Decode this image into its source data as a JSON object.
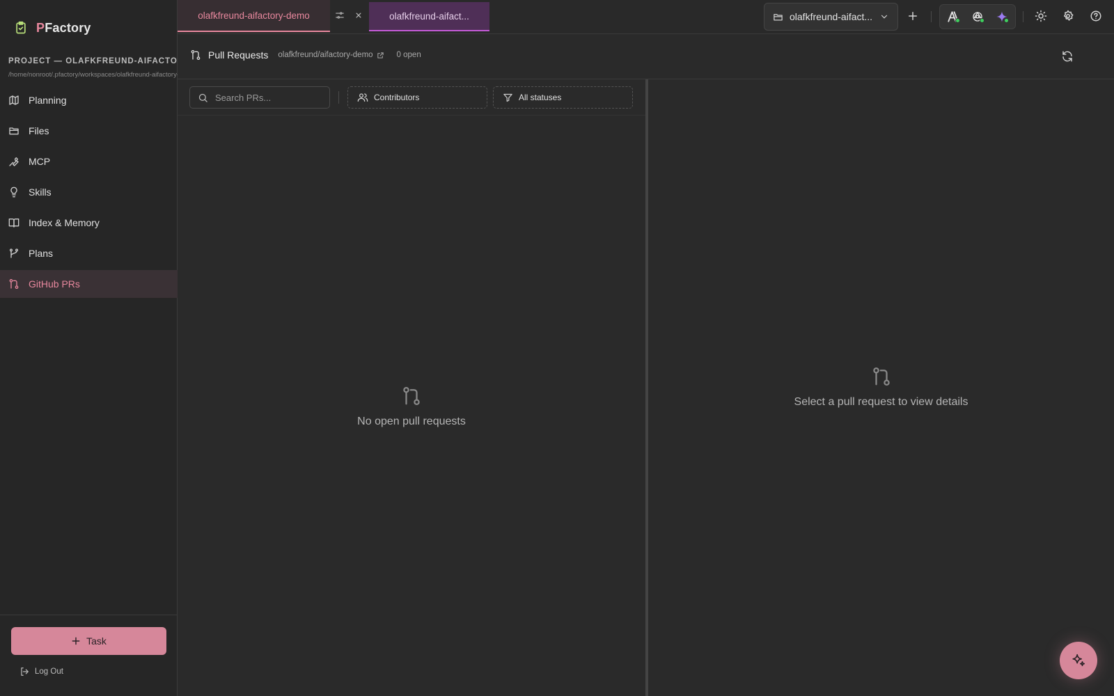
{
  "app": {
    "logo_prefix": "P",
    "logo_rest": "Factory"
  },
  "sidebar": {
    "project_label": "PROJECT — OLAFKFREUND-AIFACTORY-DEMO",
    "project_path": "/home/nonroot/.pfactory/workspaces/olafkfreund-aifactory-demo",
    "items": [
      {
        "label": "Planning",
        "icon": "map-icon"
      },
      {
        "label": "Files",
        "icon": "folder-icon"
      },
      {
        "label": "MCP",
        "icon": "wrench-icon"
      },
      {
        "label": "Skills",
        "icon": "lightbulb-icon"
      },
      {
        "label": "Index & Memory",
        "icon": "book-icon"
      },
      {
        "label": "Plans",
        "icon": "git-branch-icon"
      },
      {
        "label": "GitHub PRs",
        "icon": "git-pull-request-icon",
        "active": true
      }
    ],
    "task_button": "Task",
    "logout": "Log Out"
  },
  "topbar": {
    "tabs": [
      {
        "label": "olafkfreund-aifactory-demo"
      },
      {
        "label": "olafkfreund-aifact..."
      }
    ],
    "project_select": "olafkfreund-aifact..."
  },
  "pr": {
    "title": "Pull Requests",
    "repo": "olafkfreund/aifactory-demo",
    "open_count": "0 open",
    "search_placeholder": "Search PRs...",
    "contributors_filter": "Contributors",
    "status_filter": "All statuses",
    "empty_list": "No open pull requests",
    "empty_detail": "Select a pull request to view details"
  },
  "colors": {
    "accent": "#e8889e",
    "tab2_accent": "#c45ad6",
    "status_online": "#3ecf5e",
    "background": "#2a2a2a"
  }
}
